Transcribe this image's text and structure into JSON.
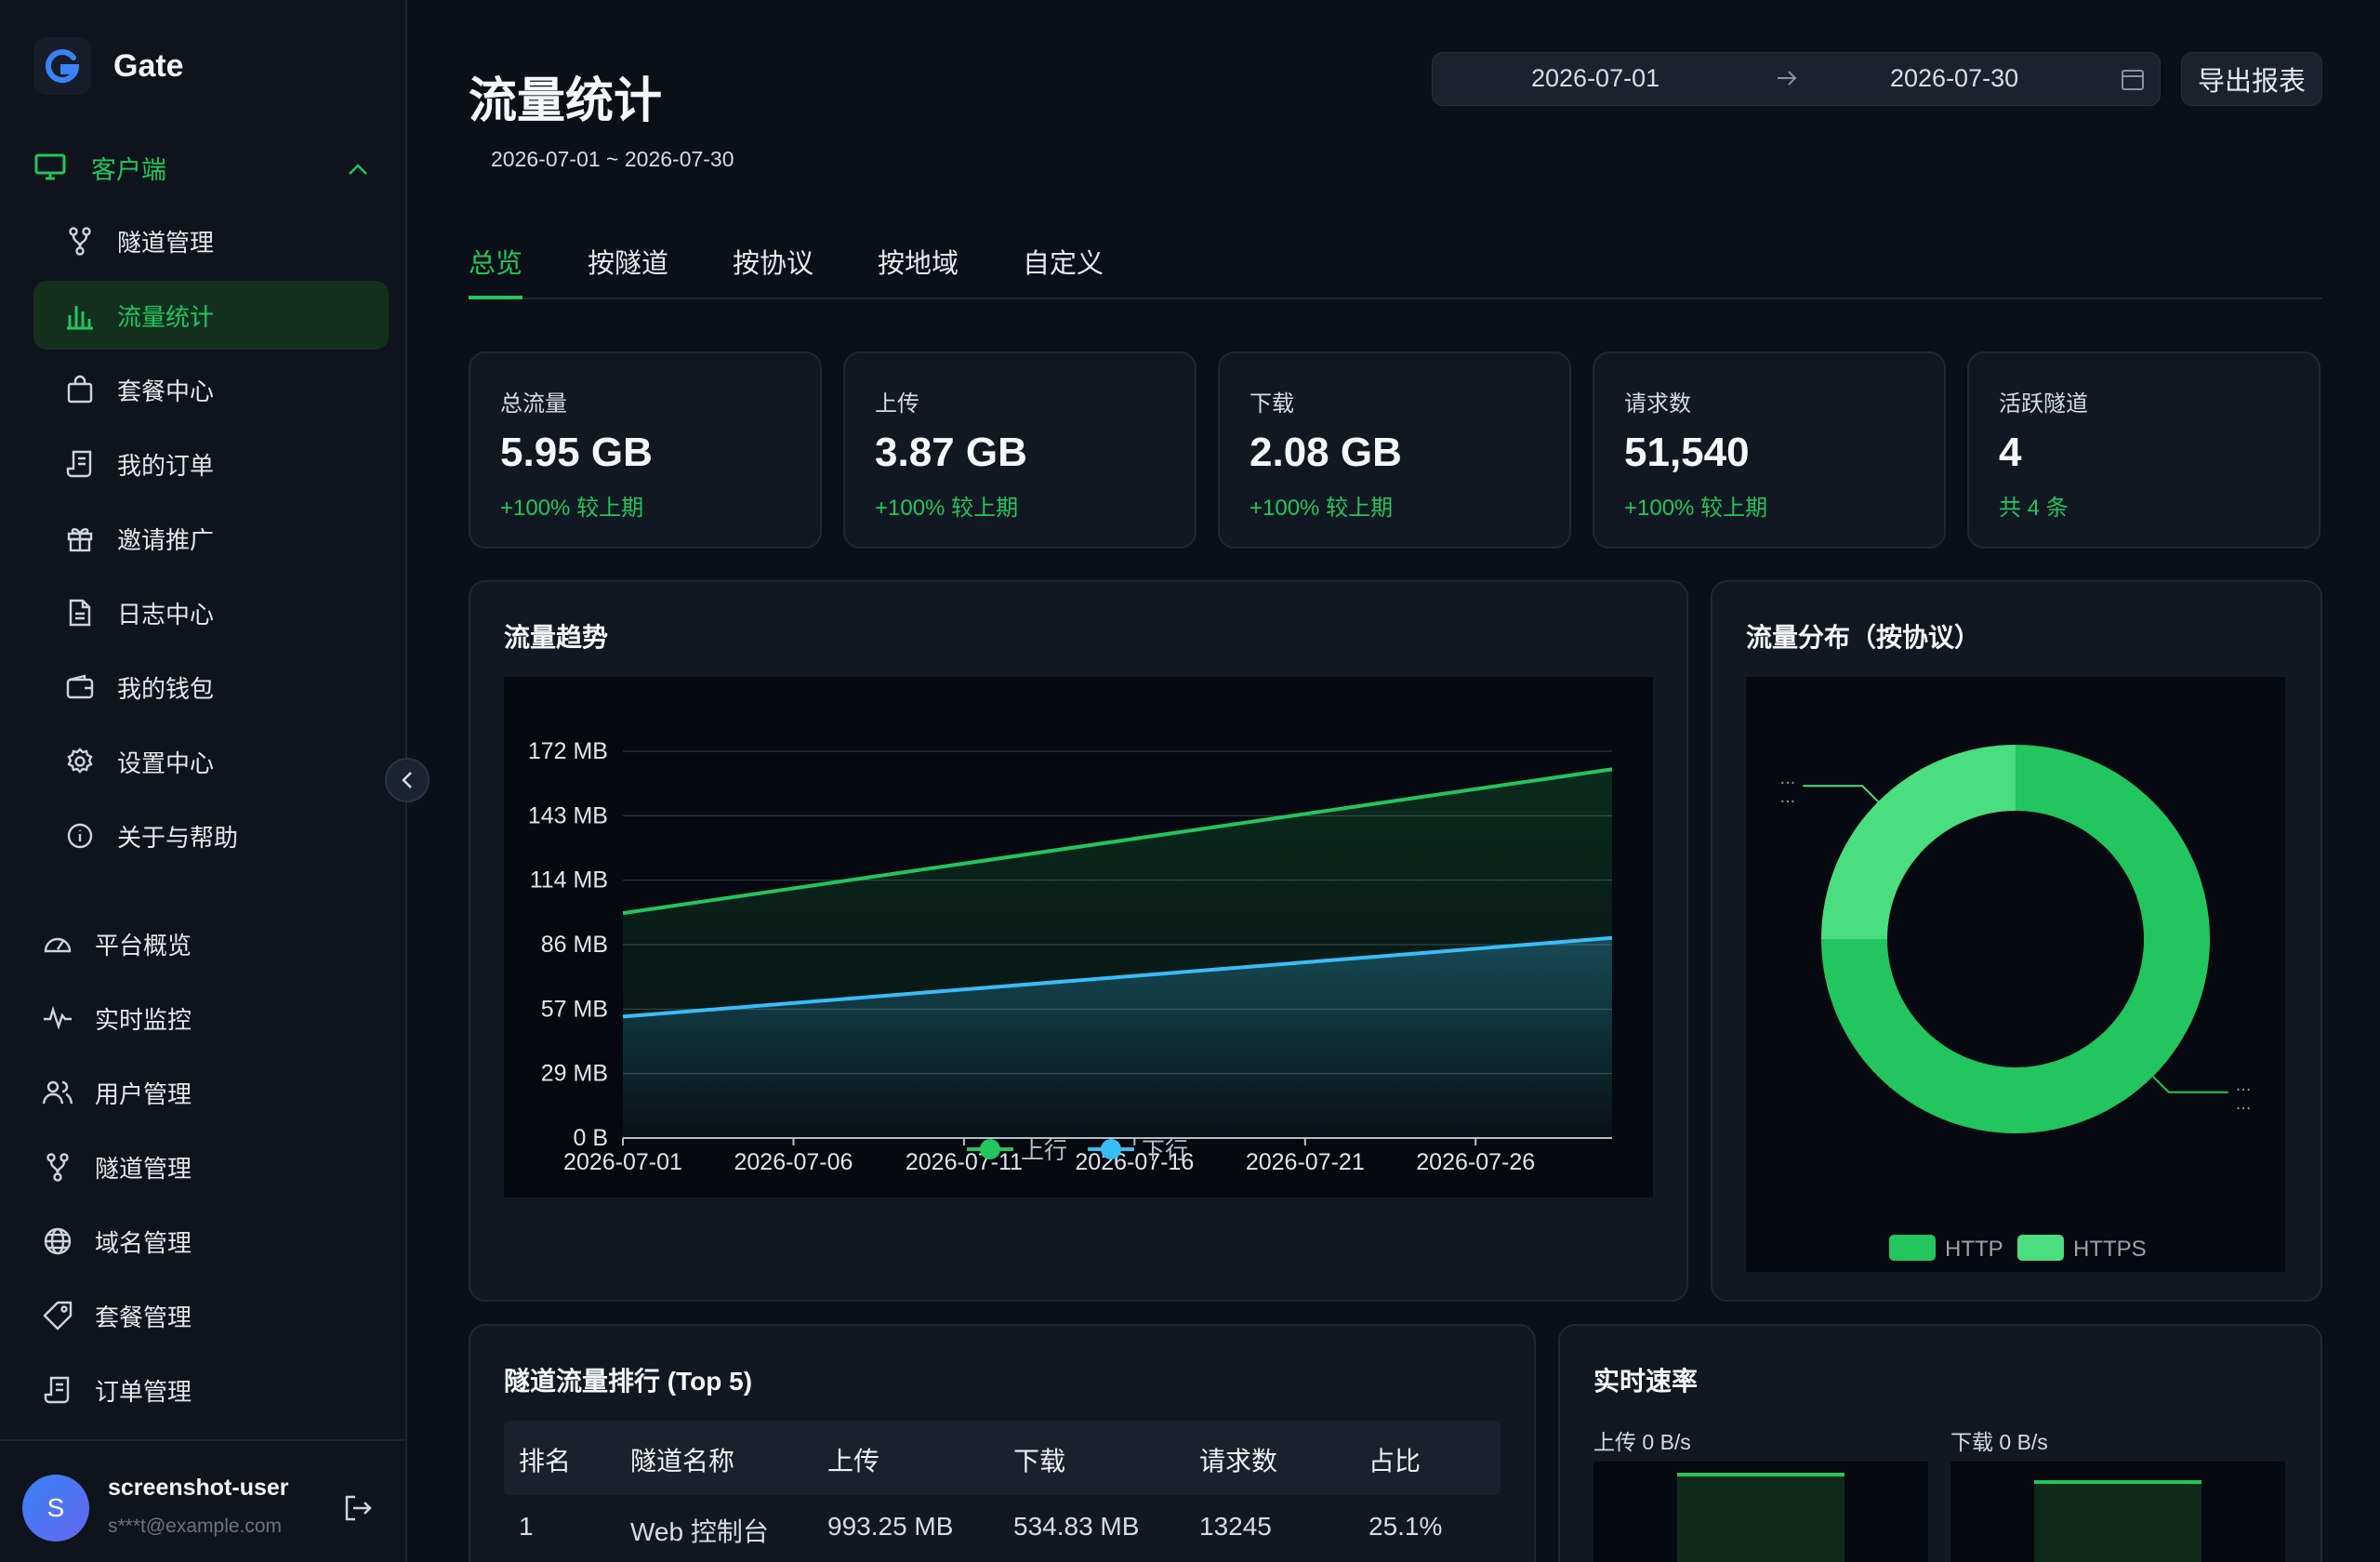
{
  "app": {
    "name": "Gate"
  },
  "sidebar": {
    "group_label": "客户端",
    "sub_items": [
      {
        "label": "隧道管理",
        "icon": "fork-icon"
      },
      {
        "label": "流量统计",
        "icon": "bar-chart-icon",
        "active": true
      },
      {
        "label": "套餐中心",
        "icon": "bag-icon"
      },
      {
        "label": "我的订单",
        "icon": "receipt-icon"
      },
      {
        "label": "邀请推广",
        "icon": "gift-icon"
      },
      {
        "label": "日志中心",
        "icon": "document-icon"
      },
      {
        "label": "我的钱包",
        "icon": "wallet-icon"
      },
      {
        "label": "设置中心",
        "icon": "gear-icon"
      },
      {
        "label": "关于与帮助",
        "icon": "info-icon"
      }
    ],
    "main_items": [
      {
        "label": "平台概览",
        "icon": "gauge-icon"
      },
      {
        "label": "实时监控",
        "icon": "pulse-icon"
      },
      {
        "label": "用户管理",
        "icon": "users-icon"
      },
      {
        "label": "隧道管理",
        "icon": "fork-icon"
      },
      {
        "label": "域名管理",
        "icon": "globe-icon"
      },
      {
        "label": "套餐管理",
        "icon": "tag-icon"
      },
      {
        "label": "订单管理",
        "icon": "receipt-icon"
      }
    ],
    "user": {
      "initial": "S",
      "name": "screenshot-user",
      "email": "s***t@example.com"
    }
  },
  "header": {
    "title": "流量统计",
    "subtitle": "2026-07-01 ~ 2026-07-30",
    "date_from": "2026-07-01",
    "date_to": "2026-07-30",
    "export_label": "导出报表"
  },
  "tabs": [
    {
      "label": "总览",
      "active": true
    },
    {
      "label": "按隧道"
    },
    {
      "label": "按协议"
    },
    {
      "label": "按地域"
    },
    {
      "label": "自定义"
    }
  ],
  "stats": [
    {
      "label": "总流量",
      "value": "5.95 GB",
      "change": "+100% 较上期"
    },
    {
      "label": "上传",
      "value": "3.87 GB",
      "change": "+100% 较上期"
    },
    {
      "label": "下载",
      "value": "2.08 GB",
      "change": "+100% 较上期"
    },
    {
      "label": "请求数",
      "value": "51,540",
      "change": "+100% 较上期"
    },
    {
      "label": "活跃隧道",
      "value": "4",
      "change": "共 4 条"
    }
  ],
  "trend": {
    "title": "流量趋势",
    "chart_data": {
      "type": "area",
      "x": [
        "2026-07-01",
        "2026-07-06",
        "2026-07-11",
        "2026-07-16",
        "2026-07-21",
        "2026-07-26"
      ],
      "y_ticks": [
        "0 B",
        "29 MB",
        "57 MB",
        "86 MB",
        "114 MB",
        "143 MB",
        "172 MB"
      ],
      "ylim": [
        0,
        172
      ],
      "y_unit": "MB",
      "xlim": [
        0,
        29
      ],
      "series": [
        {
          "name": "上行",
          "color": "#22c55e",
          "start": [
            0,
            100
          ],
          "end": [
            29,
            164
          ]
        },
        {
          "name": "下行",
          "color": "#38bdf8",
          "start": [
            0,
            54
          ],
          "end": [
            29,
            89
          ]
        }
      ],
      "legend_position": "bottom"
    }
  },
  "distribution": {
    "title": "流量分布（按协议）",
    "chart_data": {
      "type": "pie",
      "labels": [
        "HTTP",
        "HTTPS"
      ],
      "values": [
        0.75,
        0.25
      ],
      "colors": [
        "#22c55e",
        "#4ade80"
      ],
      "slice_labels": [
        "...",
        "..."
      ],
      "legend_position": "bottom"
    }
  },
  "ranking": {
    "title": "隧道流量排行 (Top 5)",
    "columns": [
      "排名",
      "隧道名称",
      "上传",
      "下载",
      "请求数",
      "占比"
    ],
    "rows": [
      [
        "1",
        "Web 控制台",
        "993.25 MB",
        "534.83 MB",
        "13245",
        "25.1%"
      ]
    ]
  },
  "realtime": {
    "title": "实时速率",
    "upload_label": "上传 0 B/s",
    "download_label": "下载 0 B/s"
  }
}
